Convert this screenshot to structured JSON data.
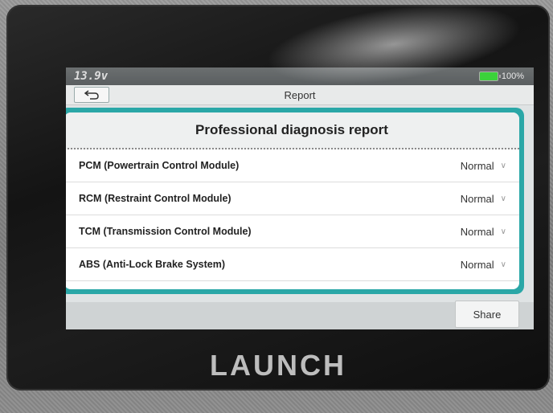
{
  "status": {
    "voltage": "13.9v",
    "battery_percent": "100%",
    "accent": "#2aa7a7"
  },
  "header": {
    "title": "Report",
    "back_icon": "back-arrow-icon"
  },
  "report": {
    "heading": "Professional diagnosis report",
    "modules": [
      {
        "name": "PCM (Powertrain Control Module)",
        "status": "Normal"
      },
      {
        "name": "RCM (Restraint Control Module)",
        "status": "Normal"
      },
      {
        "name": "TCM (Transmission Control Module)",
        "status": "Normal"
      },
      {
        "name": "ABS (Anti-Lock Brake System)",
        "status": "Normal"
      }
    ]
  },
  "footer": {
    "share_label": "Share"
  },
  "device": {
    "brand": "LAUNCH"
  }
}
